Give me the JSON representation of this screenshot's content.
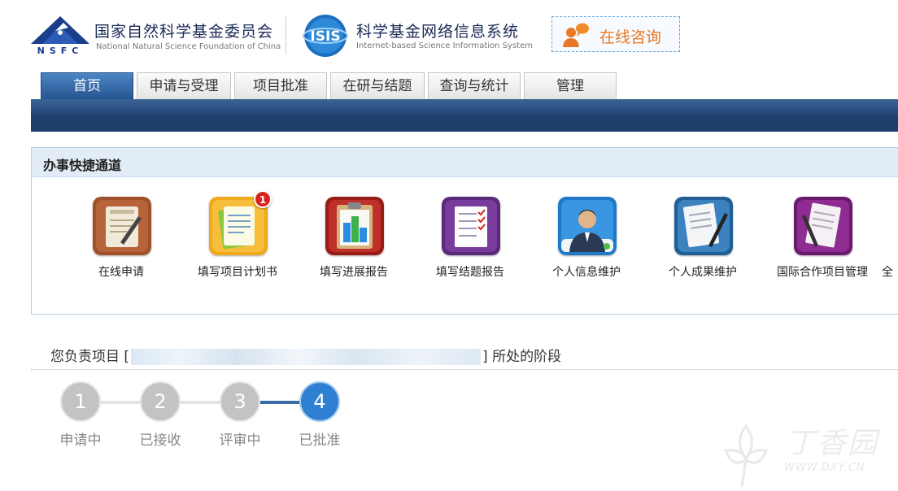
{
  "header": {
    "nsfc_letters": "NSFC",
    "nsfc_name": "国家自然科学基金委员会",
    "nsfc_name_en": "National Natural Science Foundation of China",
    "isis_logo_text": "ISIS",
    "system_name": "科学基金网络信息系统",
    "system_name_en": "Internet-based Science Information System",
    "consult_label": "在线咨询"
  },
  "nav": {
    "tabs": [
      {
        "label": "首页"
      },
      {
        "label": "申请与受理"
      },
      {
        "label": "项目批准"
      },
      {
        "label": "在研与结题"
      },
      {
        "label": "查询与统计"
      },
      {
        "label": "管理"
      }
    ]
  },
  "quick": {
    "title": "办事快捷通道",
    "items": [
      {
        "label": "在线申请"
      },
      {
        "label": "填写项目计划书",
        "badge": "1"
      },
      {
        "label": "填写进展报告"
      },
      {
        "label": "填写结题报告"
      },
      {
        "label": "个人信息维护"
      },
      {
        "label": "个人成果维护"
      },
      {
        "label": "国际合作项目管理"
      },
      {
        "label": "全"
      }
    ]
  },
  "project": {
    "prefix": "您负责项目 [",
    "suffix": "] 所处的阶段"
  },
  "steps": [
    {
      "num": "1",
      "label": "申请中",
      "state": "done"
    },
    {
      "num": "2",
      "label": "已接收",
      "state": "done"
    },
    {
      "num": "3",
      "label": "评审中",
      "state": "done"
    },
    {
      "num": "4",
      "label": "已批准",
      "state": "current"
    }
  ],
  "watermark": {
    "text": "丁香园",
    "url": "WWW.DXY.CN"
  },
  "colors": {
    "nav_active": "#2f6bb0",
    "nav_band": "#24466f",
    "step_current": "#2f7fd2",
    "step_done": "#c3c3c3",
    "consult_text": "#e87722"
  }
}
